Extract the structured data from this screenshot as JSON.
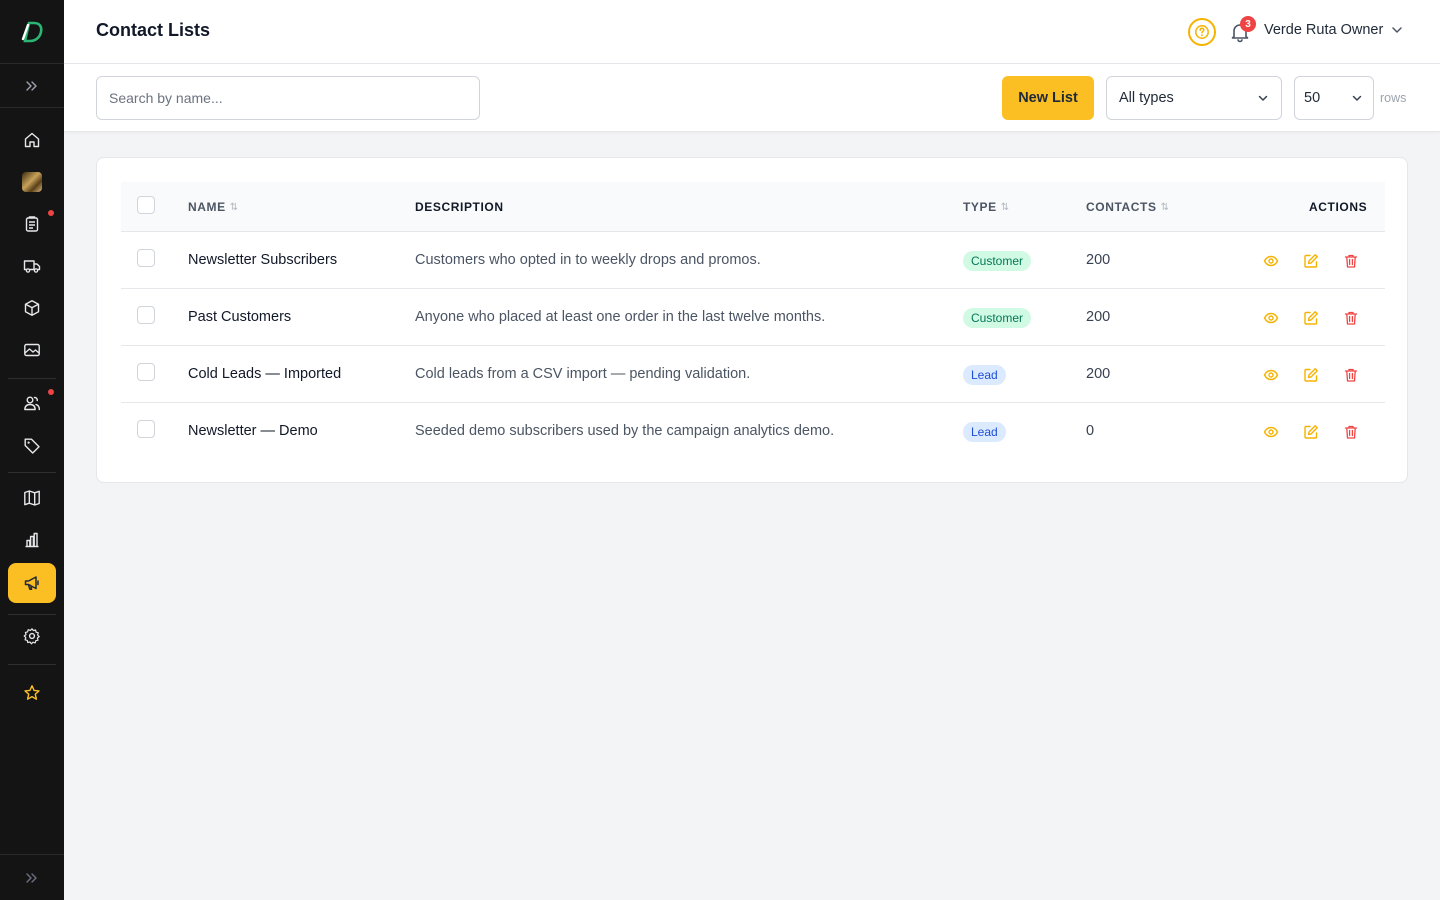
{
  "header": {
    "title": "Contact Lists",
    "help_icon": "question-circle-icon",
    "notification_count": "3",
    "user_name": "Verde Ruta Owner"
  },
  "toolbar": {
    "search_placeholder": "Search by name...",
    "new_list_label": "New List",
    "type_filter_value": "All types",
    "rows_value": "50",
    "rows_label": "rows"
  },
  "sidebar": {
    "items": [
      {
        "icon": "home-icon"
      },
      {
        "icon": "store-thumbnail"
      },
      {
        "icon": "clipboard-icon",
        "dot": true
      },
      {
        "icon": "truck-icon"
      },
      {
        "icon": "box-icon"
      },
      {
        "icon": "image-icon"
      },
      {
        "icon": "users-icon",
        "dot": true
      },
      {
        "icon": "tag-icon"
      },
      {
        "icon": "map-icon"
      },
      {
        "icon": "bar-chart-icon"
      },
      {
        "icon": "megaphone-icon",
        "active": true
      },
      {
        "icon": "gear-icon"
      },
      {
        "icon": "star-icon"
      }
    ]
  },
  "table": {
    "columns": {
      "name": "NAME",
      "description": "DESCRIPTION",
      "type": "TYPE",
      "contacts": "CONTACTS",
      "actions": "ACTIONS"
    },
    "rows": [
      {
        "name": "Newsletter Subscribers",
        "description": "Customers who opted in to weekly drops and promos.",
        "type": "Customer",
        "contacts": "200"
      },
      {
        "name": "Past Customers",
        "description": "Anyone who placed at least one order in the last twelve months.",
        "type": "Customer",
        "contacts": "200"
      },
      {
        "name": "Cold Leads — Imported",
        "description": "Cold leads from a CSV import — pending validation.",
        "type": "Lead",
        "contacts": "200"
      },
      {
        "name": "Newsletter — Demo",
        "description": "Seeded demo subscribers used by the campaign analytics demo.",
        "type": "Lead",
        "contacts": "0"
      }
    ]
  },
  "colors": {
    "accent": "#fbbf24",
    "sidebar_bg": "#141414",
    "customer_badge": "#d1fae5",
    "lead_badge": "#dbeafe",
    "delete": "#ef4444"
  }
}
